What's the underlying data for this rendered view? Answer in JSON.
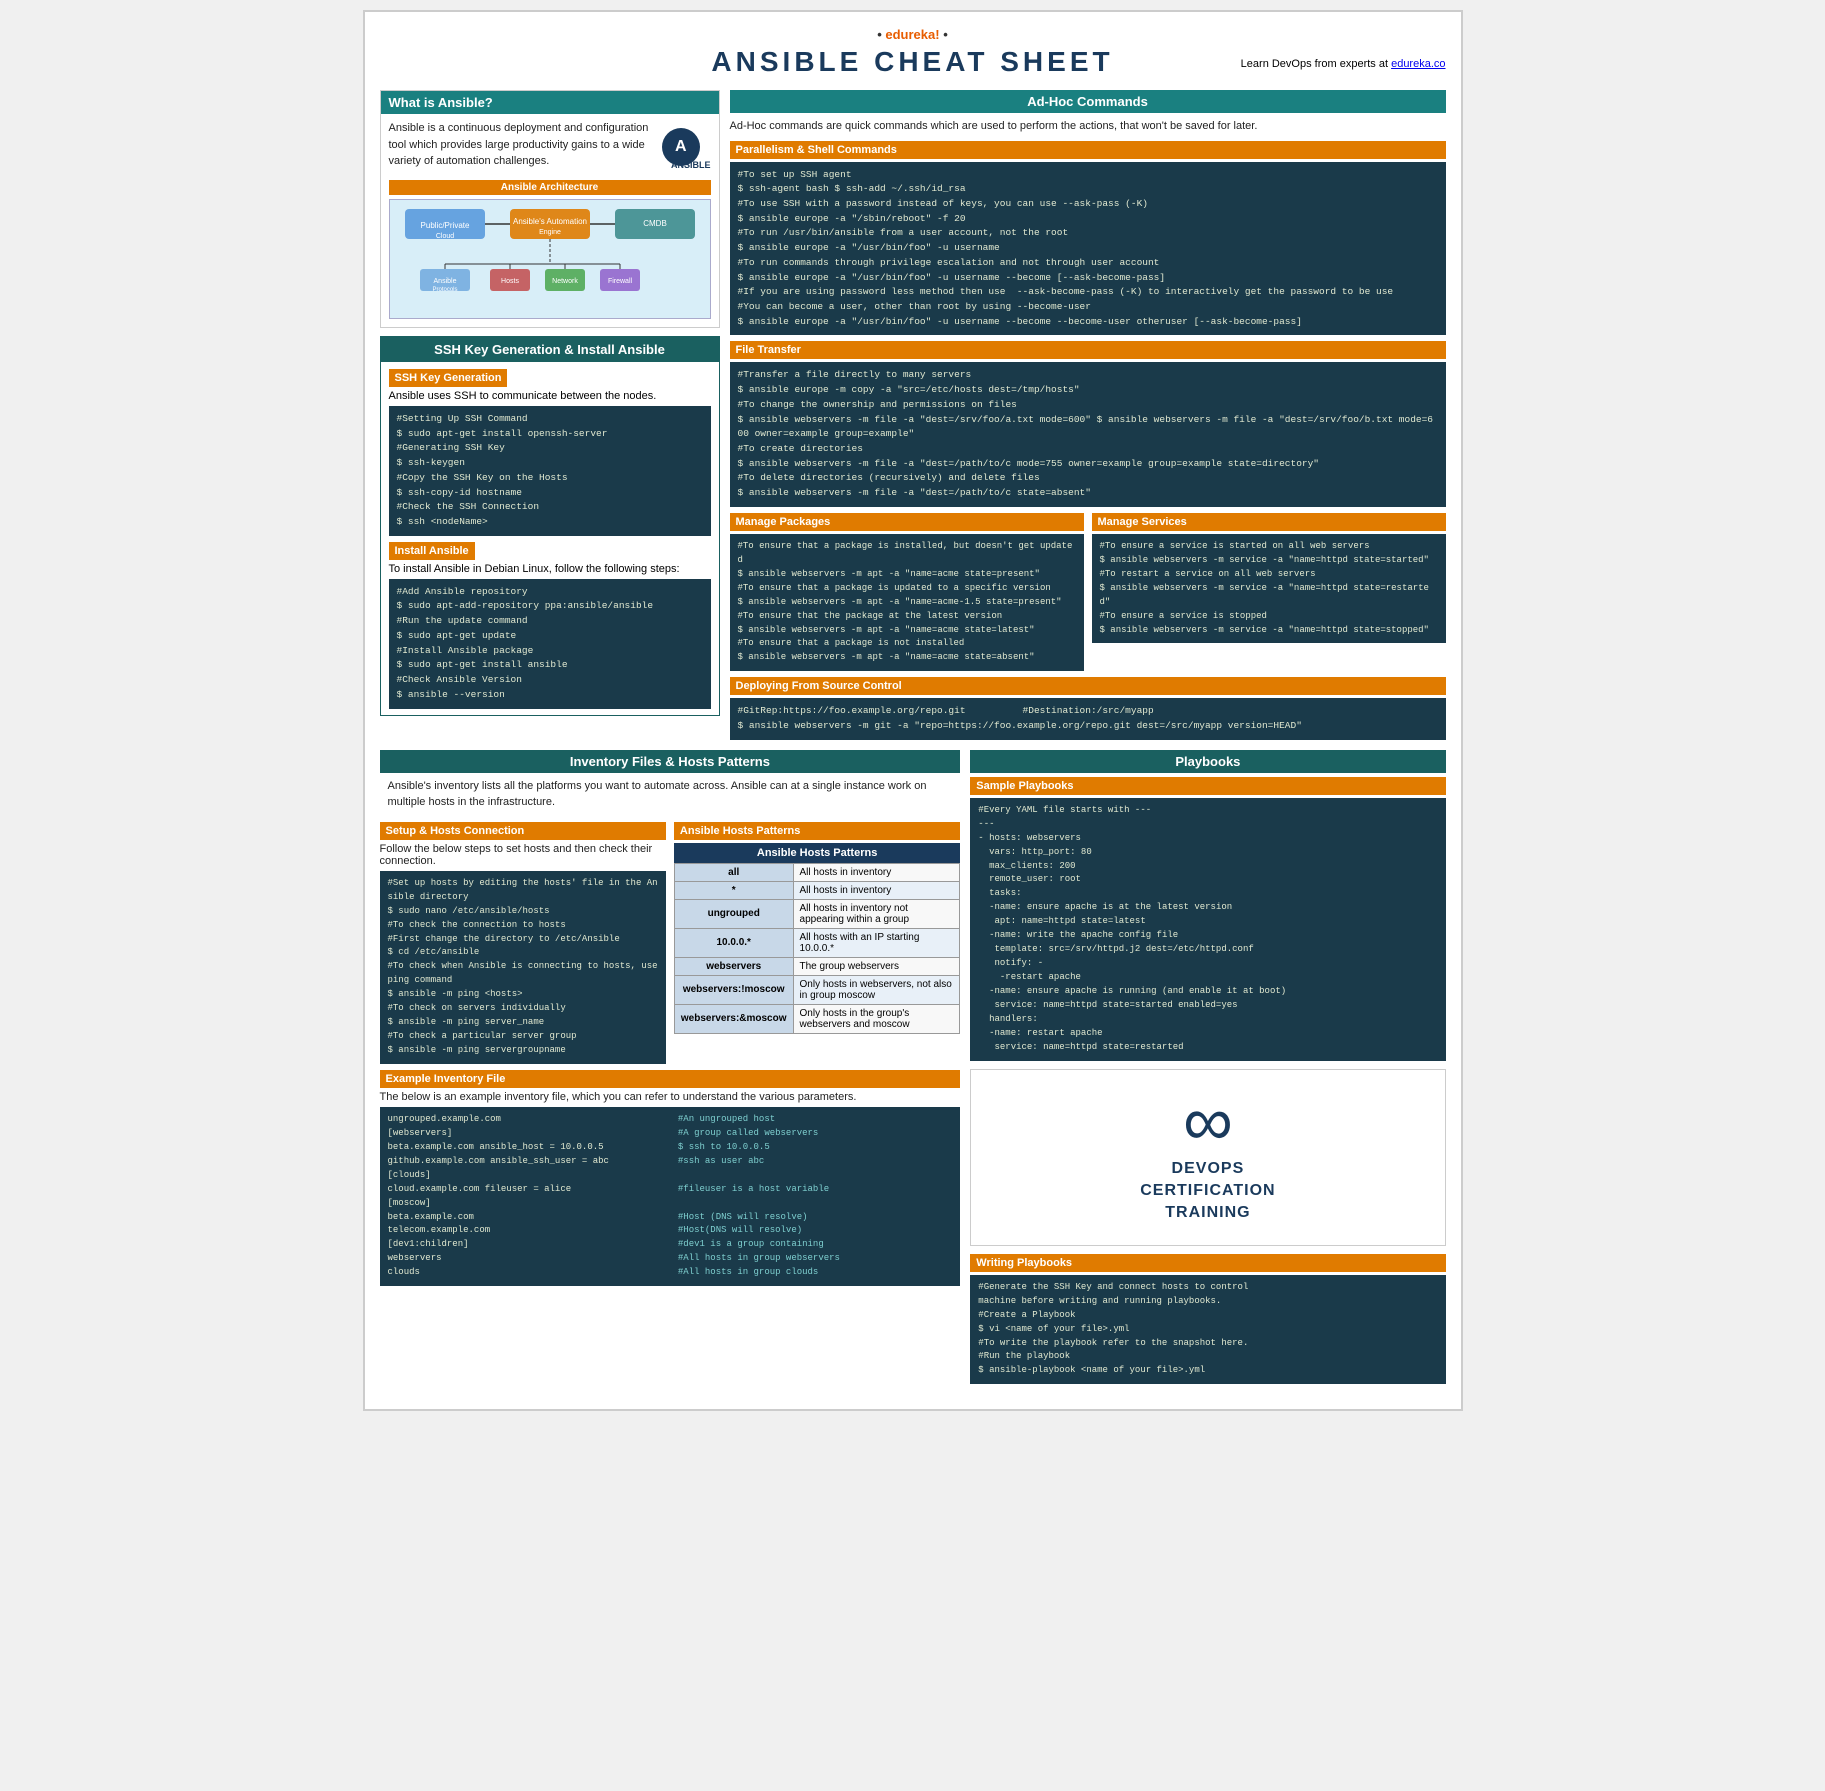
{
  "brand": {
    "name": "edureka!",
    "dots": "• •",
    "tagline": "Learn DevOps from experts at",
    "site": "edureka.co"
  },
  "title": "ANSIBLE CHEAT SHEET",
  "what_is_ansible": {
    "header": "What is Ansible?",
    "description": "Ansible is a continuous deployment and configuration tool which provides large productivity gains to a wide variety of automation challenges.",
    "logo_letter": "A",
    "logo_label": "ANSIBLE",
    "arch_header": "Ansible Architecture"
  },
  "ssh_section": {
    "title": "SSH Key Generation & Install Ansible",
    "ssh_gen_header": "SSH Key Generation",
    "ssh_gen_desc": "Ansible uses SSH to communicate between the nodes.",
    "ssh_gen_code": "#Setting Up SSH Command\n$ sudo apt-get install openssh-server\n#Generating SSH Key\n$ ssh-keygen\n#Copy the SSH Key on the Hosts\n$ ssh-copy-id hostname\n#Check the SSH Connection\n$ ssh <nodeName>",
    "install_header": "Install Ansible",
    "install_desc": "To install Ansible in Debian Linux, follow the following steps:",
    "install_code": "#Add Ansible repository\n$ sudo apt-add-repository ppa:ansible/ansible\n#Run the update command\n$ sudo apt-get update\n#Install Ansible package\n$ sudo apt-get install ansible\n#Check Ansible Version\n$ ansible --version"
  },
  "adhoc": {
    "header": "Ad-Hoc Commands",
    "desc": "Ad-Hoc commands are quick commands which are used to perform the actions, that won't be saved for later.",
    "parallelism_header": "Parallelism & Shell Commands",
    "parallelism_code": "#To set up SSH agent\n$ ssh-agent bash $ ssh-add ~/.ssh/id_rsa\n#To use SSH with a password instead of keys, you can use --ask-pass (-K)\n$ ansible europe -a \"/sbin/reboot\" -f 20\n#To run /usr/bin/ansible from a user account, not the root\n$ ansible europe -a \"/usr/bin/foo\" -u username\n#To run commands through privilege escalation and not through user account\n$ ansible europe -a \"/usr/bin/foo\" -u username --become [--ask-become-pass]\n#If you are using password less method then use --ask-become-pass (-K) to interactively get the password to be use\n#You can become a user, other than root by using --become-user\n$ ansible europe -a \"/usr/bin/foo\" -u username --become --become-user otheruser [--ask-become-pass]",
    "file_transfer_header": "File Transfer",
    "file_transfer_code": "#Transfer a file directly to many servers\n$ ansible europe -m copy -a \"src=/etc/hosts dest=/tmp/hosts\"\n#To change the ownership and permissions on files\n$ ansible webservers -m file -a \"dest=/srv/foo/a.txt mode=600\" $ ansible webservers -m file -a \"dest=/srv/foo/b.txt mode=600 owner=example group=example\"\n#To create directories\n$ ansible webservers -m file -a \"dest=/path/to/c mode=755 owner=example group=example state=directory\"\n#To delete directories (recursively) and delete files\n$ ansible webservers -m file -a \"dest=/path/to/c state=absent\"",
    "manage_pkg_header": "Manage Packages",
    "manage_pkg_code": "#To ensure that a package is installed, but doesn't get updated\n$ ansible webservers -m apt -a \"name=acme state=present\"\n#To ensure that a package is updated to a specific version\n$ ansible webservers -m apt -a \"name=acme-1.5 state=present\"\n#To ensure that the package at the latest version\n$ ansible webservers -m apt -a \"name=acme state=latest\"\n#To ensure that a package is not installed\n$ ansible webservers -m apt -a \"name=acme state=absent\"",
    "manage_svc_header": "Manage Services",
    "manage_svc_code": "#To ensure a service is started on all web servers\n$ ansible webservers -m service -a \"name=httpd state=started\"\n#To restart a service on all web servers\n$ ansible webservers -m service -a \"name=httpd state=restarted\"\n#To ensure a service is stopped\n$ ansible webservers -m service -a \"name=httpd state=stopped\"",
    "deploy_header": "Deploying From Source Control",
    "deploy_code": "#GitRep:https://foo.example.org/repo.git          #Destination:/src/myapp\n$ ansible webservers -m git -a \"repo=https://foo.example.org/repo.git dest=/src/myapp version=HEAD\""
  },
  "inventory": {
    "main_header": "Inventory Files & Hosts Patterns",
    "desc": "Ansible's inventory lists all the platforms you want to automate across. Ansible can at a single instance work on multiple hosts in the infrastructure.",
    "setup_header": "Setup & Hosts Connection",
    "setup_desc": "Follow the below steps to set hosts and then check their connection.",
    "setup_code": "#Set up hosts by editing the hosts' file in the Ansible directory\n$ sudo nano /etc/ansible/hosts\n#To check the connection to hosts\n#First change the directory to /etc/Ansible\n$ cd /etc/ansible\n#To check when Ansible is connecting to hosts, use ping command\n$ ansible -m ping <hosts>\n#To check on servers individually\n$ ansible -m ping server_name\n#To check a particular server group\n$ ansible -m ping servergroupname",
    "hosts_patterns_header": "Ansible Hosts Patterns",
    "table_col1": "Ansible Hosts Patterns",
    "table_col2": "",
    "table_rows": [
      {
        "pattern": "all",
        "desc": "All hosts in inventory"
      },
      {
        "pattern": "*",
        "desc": "All hosts in inventory"
      },
      {
        "pattern": "ungrouped",
        "desc": "All hosts in inventory not appearing within a group"
      },
      {
        "pattern": "10.0.0.*",
        "desc": "All hosts with an IP starting 10.0.0.*"
      },
      {
        "pattern": "webservers",
        "desc": "The group webservers"
      },
      {
        "pattern": "webservers:!moscow",
        "desc": "Only hosts in webservers, not also in group moscow"
      },
      {
        "pattern": "webservers:&moscow",
        "desc": "Only hosts in the group's webservers and moscow"
      }
    ],
    "example_inv_header": "Example Inventory File",
    "example_inv_desc": "The below is an example inventory file, which you can refer to understand the various parameters.",
    "example_inv_left": "ungrouped.example.com\n[webservers]\nbeta.example.com ansible_host = 10.0.0.5\ngithub.example.com ansible_ssh_user = abc\n[clouds]\ncloud.example.com fileuser = alice\n[moscow]\nbeta.example.com\ntelecom.example.com\n[dev1:children]\nwebservers\nclouds",
    "example_inv_right": "#An ungrouped host\n#A group called webservers\n$ ssh to 10.0.0.5\n#ssh as user abc\n\n#fileuser is a host variable\n\n#Host (DNS will resolve)\n#Host(DNS will resolve)\n#dev1 is a group containing\n#All hosts in group webservers\n#All hosts in group clouds"
  },
  "playbooks": {
    "header": "Playbooks",
    "sample_header": "Sample Playbooks",
    "sample_code": "#Every YAML file starts with ---\n---\n- hosts: webservers\n  vars: http_port: 80\n  max_clients: 200\n  remote_user: root\n  tasks:\n  -name: ensure apache is at the latest version\n   apt: name=httpd state=latest\n  -name: write the apache config file\n   template: src=/srv/httpd.j2 dest=/etc/httpd.conf\n   notify: -\n    -restart apache\n  -name: ensure apache is running (and enable it at boot)\n   service: name=httpd state=started enabled=yes\n  handlers:\n  -name: restart apache\n   service: name=httpd state=restarted",
    "writing_header": "Writing Playbooks",
    "writing_code": "#Generate the SSH Key and connect hosts to control\nmachine before writing and running playbooks.\n#Create a Playbook\n$ vi <name of your file>.yml\n#To write the playbook refer to the snapshot here.\n#Run the playbook\n$ ansible-playbook <name of your file>.yml"
  },
  "devops_cert": {
    "symbol": "∞",
    "line1": "DEVOPS",
    "line2": "CERTIFICATION",
    "line3": "TRAINING"
  }
}
